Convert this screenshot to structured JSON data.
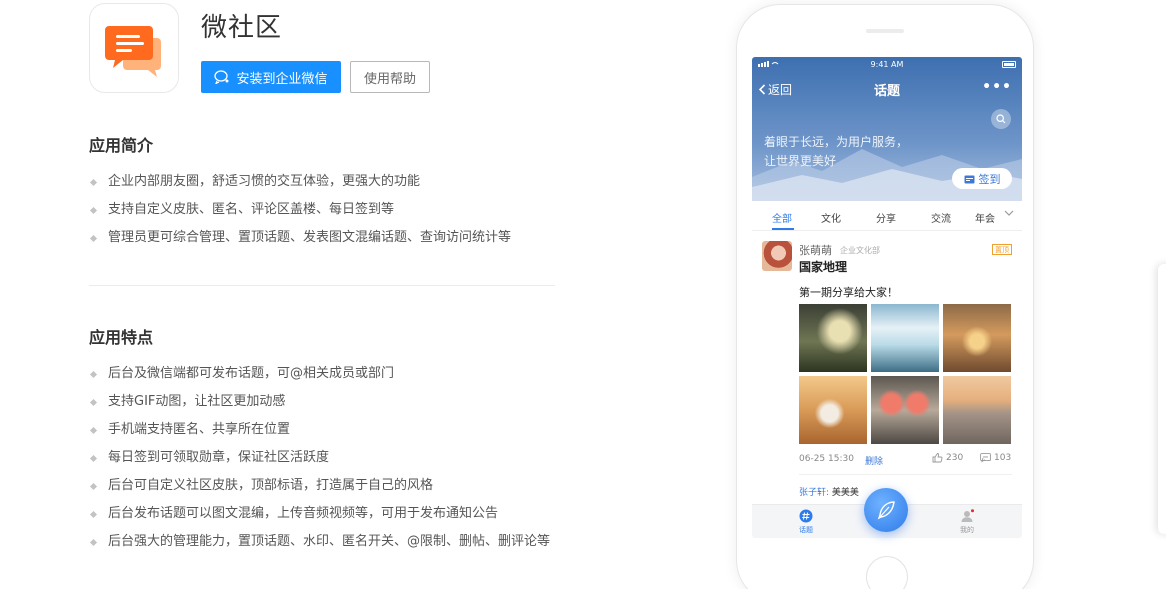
{
  "app": {
    "name": "微社区",
    "install_label": "安装到企业微信",
    "help_label": "使用帮助",
    "accent_color": "#1890ff",
    "icon": "chat-bubbles-icon"
  },
  "intro": {
    "title": "应用简介",
    "items": [
      "企业内部朋友圈，舒适习惯的交互体验，更强大的功能",
      "支持自定义皮肤、匿名、评论区盖楼、每日签到等",
      "管理员更可综合管理、置顶话题、发表图文混编话题、查询访问统计等"
    ]
  },
  "features": {
    "title": "应用特点",
    "items": [
      "后台及微信端都可发布话题，可@相关成员或部门",
      "支持GIF动图，让社区更加动感",
      "手机端支持匿名、共享所在位置",
      "每日签到可领取勋章，保证社区活跃度",
      "后台可自定义社区皮肤，顶部标语，打造属于自己的风格",
      "后台发布话题可以图文混编，上传音频视频等，可用于发布通知公告",
      "后台强大的管理能力，置顶话题、水印、匿名开关、@限制、删帖、删评论等"
    ]
  },
  "phone": {
    "status_time": "9:41 AM",
    "back_label": "返回",
    "nav_title": "话题",
    "more_label": "•••",
    "hero_line1": "着眼于长远，为用户服务，",
    "hero_line2": "让世界更美好",
    "signin_label": "签到",
    "tabs": [
      "全部",
      "文化",
      "分享",
      "交流",
      "年会"
    ],
    "post": {
      "author": "张萌萌",
      "dept": "企业文化部",
      "tag": "置顶",
      "topic": "国家地理",
      "text": "第一期分享给大家！",
      "date": "06-25 15:30",
      "delete_label": "删除",
      "likes": "230",
      "comments": "103"
    },
    "comment": {
      "who": "张子轩:",
      "text": "美美美"
    },
    "bottom": {
      "topic_label": "话题",
      "mine_label": "我的"
    }
  }
}
